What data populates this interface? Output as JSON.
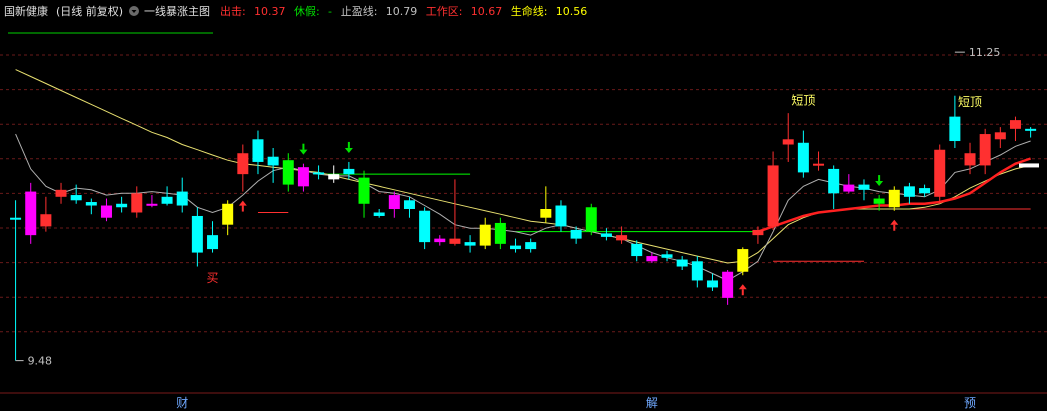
{
  "header": {
    "stock_name": "国新健康",
    "period_label": "(日线 前复权)",
    "indicator_name": "一线暴涨主图",
    "stats": [
      {
        "label": "出击:",
        "value": "10.37",
        "color": "#ff3030"
      },
      {
        "label": "休假:",
        "value": "-",
        "color": "#00e000"
      },
      {
        "label": "止盈线:",
        "value": "10.79",
        "color": "#c0c0c0"
      },
      {
        "label": "工作区:",
        "value": "10.67",
        "color": "#ff3030"
      },
      {
        "label": "生命线:",
        "value": "10.56",
        "color": "#ffff00"
      }
    ]
  },
  "chart_data": {
    "type": "candlestick",
    "ylim": [
      9.3,
      11.4
    ],
    "grid": true,
    "price_max_label": "11.25",
    "price_min_label": "9.48",
    "price_max": 11.25,
    "price_min": 9.48,
    "x_markers": [
      {
        "label": "财",
        "index": 11
      },
      {
        "label": "解",
        "index": 42
      },
      {
        "label": "预",
        "index": 63
      }
    ],
    "candles": [
      {
        "o": 10.3,
        "h": 10.4,
        "l": 9.48,
        "c": 10.3,
        "color": "#00ffff"
      },
      {
        "o": 10.2,
        "h": 10.5,
        "l": 10.15,
        "c": 10.45,
        "color": "#ff00ff"
      },
      {
        "o": 10.32,
        "h": 10.42,
        "l": 10.22,
        "c": 10.25,
        "color": "#ff3030"
      },
      {
        "o": 10.42,
        "h": 10.5,
        "l": 10.38,
        "c": 10.46,
        "color": "#ff3030"
      },
      {
        "o": 10.43,
        "h": 10.49,
        "l": 10.38,
        "c": 10.4,
        "color": "#00ffff"
      },
      {
        "o": 10.37,
        "h": 10.41,
        "l": 10.32,
        "c": 10.39,
        "color": "#00ffff"
      },
      {
        "o": 10.37,
        "h": 10.41,
        "l": 10.28,
        "c": 10.3,
        "color": "#ff00ff"
      },
      {
        "o": 10.38,
        "h": 10.42,
        "l": 10.33,
        "c": 10.36,
        "color": "#00ffff"
      },
      {
        "o": 10.33,
        "h": 10.48,
        "l": 10.3,
        "c": 10.44,
        "color": "#ff3030"
      },
      {
        "o": 10.37,
        "h": 10.43,
        "l": 10.36,
        "c": 10.38,
        "color": "#ff00ff"
      },
      {
        "o": 10.42,
        "h": 10.48,
        "l": 10.37,
        "c": 10.38,
        "color": "#00ffff"
      },
      {
        "o": 10.37,
        "h": 10.53,
        "l": 10.33,
        "c": 10.45,
        "color": "#00ffff"
      },
      {
        "o": 10.31,
        "h": 10.36,
        "l": 10.02,
        "c": 10.1,
        "color": "#00ffff"
      },
      {
        "o": 10.2,
        "h": 10.28,
        "l": 10.1,
        "c": 10.12,
        "color": "#00ffff"
      },
      {
        "o": 10.26,
        "h": 10.4,
        "l": 10.2,
        "c": 10.38,
        "color": "#ffff00"
      },
      {
        "o": 10.55,
        "h": 10.72,
        "l": 10.45,
        "c": 10.67,
        "color": "#ff3030"
      },
      {
        "o": 10.62,
        "h": 10.8,
        "l": 10.55,
        "c": 10.75,
        "color": "#00ffff"
      },
      {
        "o": 10.6,
        "h": 10.7,
        "l": 10.5,
        "c": 10.65,
        "color": "#00ffff"
      },
      {
        "o": 10.49,
        "h": 10.67,
        "l": 10.45,
        "c": 10.63,
        "color": "#00ff00"
      },
      {
        "o": 10.59,
        "h": 10.61,
        "l": 10.45,
        "c": 10.48,
        "color": "#ff00ff"
      },
      {
        "o": 10.55,
        "h": 10.6,
        "l": 10.52,
        "c": 10.56,
        "color": "#00ffff"
      },
      {
        "o": 10.55,
        "h": 10.6,
        "l": 10.5,
        "c": 10.52,
        "color": "#ffffff"
      },
      {
        "o": 10.58,
        "h": 10.62,
        "l": 10.52,
        "c": 10.55,
        "color": "#00ffff"
      },
      {
        "o": 10.53,
        "h": 10.57,
        "l": 10.3,
        "c": 10.38,
        "color": "#00ff00"
      },
      {
        "o": 10.33,
        "h": 10.35,
        "l": 10.3,
        "c": 10.31,
        "color": "#00ffff"
      },
      {
        "o": 10.43,
        "h": 10.45,
        "l": 10.3,
        "c": 10.35,
        "color": "#ff00ff"
      },
      {
        "o": 10.35,
        "h": 10.42,
        "l": 10.3,
        "c": 10.4,
        "color": "#00ffff"
      },
      {
        "o": 10.34,
        "h": 10.36,
        "l": 10.12,
        "c": 10.16,
        "color": "#00ffff"
      },
      {
        "o": 10.18,
        "h": 10.2,
        "l": 10.14,
        "c": 10.16,
        "color": "#ff00ff"
      },
      {
        "o": 10.18,
        "h": 10.52,
        "l": 10.14,
        "c": 10.15,
        "color": "#ff3030"
      },
      {
        "o": 10.16,
        "h": 10.2,
        "l": 10.1,
        "c": 10.14,
        "color": "#00ffff"
      },
      {
        "o": 10.14,
        "h": 10.3,
        "l": 10.12,
        "c": 10.26,
        "color": "#ffff00"
      },
      {
        "o": 10.15,
        "h": 10.3,
        "l": 10.12,
        "c": 10.27,
        "color": "#00ff00"
      },
      {
        "o": 10.14,
        "h": 10.18,
        "l": 10.1,
        "c": 10.12,
        "color": "#00ffff"
      },
      {
        "o": 10.12,
        "h": 10.18,
        "l": 10.1,
        "c": 10.16,
        "color": "#00ffff"
      },
      {
        "o": 10.35,
        "h": 10.48,
        "l": 10.27,
        "c": 10.3,
        "color": "#ffff00"
      },
      {
        "o": 10.37,
        "h": 10.4,
        "l": 10.22,
        "c": 10.25,
        "color": "#00ffff"
      },
      {
        "o": 10.23,
        "h": 10.25,
        "l": 10.15,
        "c": 10.18,
        "color": "#00ffff"
      },
      {
        "o": 10.36,
        "h": 10.38,
        "l": 10.2,
        "c": 10.22,
        "color": "#00ff00"
      },
      {
        "o": 10.21,
        "h": 10.24,
        "l": 10.17,
        "c": 10.19,
        "color": "#00ffff"
      },
      {
        "o": 10.2,
        "h": 10.25,
        "l": 10.15,
        "c": 10.17,
        "color": "#ff3030"
      },
      {
        "o": 10.15,
        "h": 10.17,
        "l": 10.05,
        "c": 10.08,
        "color": "#00ffff"
      },
      {
        "o": 10.08,
        "h": 10.1,
        "l": 10.04,
        "c": 10.05,
        "color": "#ff00ff"
      },
      {
        "o": 10.09,
        "h": 10.11,
        "l": 10.05,
        "c": 10.07,
        "color": "#00ffff"
      },
      {
        "o": 10.06,
        "h": 10.08,
        "l": 10.0,
        "c": 10.02,
        "color": "#00ffff"
      },
      {
        "o": 10.05,
        "h": 10.08,
        "l": 9.9,
        "c": 9.94,
        "color": "#00ffff"
      },
      {
        "o": 9.94,
        "h": 9.98,
        "l": 9.88,
        "c": 9.9,
        "color": "#00ffff"
      },
      {
        "o": 9.99,
        "h": 10.0,
        "l": 9.8,
        "c": 9.84,
        "color": "#ff00ff"
      },
      {
        "o": 9.99,
        "h": 10.13,
        "l": 9.97,
        "c": 10.12,
        "color": "#ffff00"
      },
      {
        "o": 10.2,
        "h": 10.25,
        "l": 10.15,
        "c": 10.23,
        "color": "#ff3030"
      },
      {
        "o": 10.25,
        "h": 10.68,
        "l": 10.23,
        "c": 10.6,
        "color": "#ff3030"
      },
      {
        "o": 10.75,
        "h": 10.9,
        "l": 10.62,
        "c": 10.72,
        "color": "#ff3030"
      },
      {
        "o": 10.73,
        "h": 10.8,
        "l": 10.53,
        "c": 10.56,
        "color": "#00ffff"
      },
      {
        "o": 10.6,
        "h": 10.68,
        "l": 10.57,
        "c": 10.61,
        "color": "#ff3030"
      },
      {
        "o": 10.58,
        "h": 10.6,
        "l": 10.35,
        "c": 10.44,
        "color": "#00ffff"
      },
      {
        "o": 10.49,
        "h": 10.55,
        "l": 10.44,
        "c": 10.45,
        "color": "#ff00ff"
      },
      {
        "o": 10.49,
        "h": 10.52,
        "l": 10.4,
        "c": 10.46,
        "color": "#00ffff"
      },
      {
        "o": 10.38,
        "h": 10.43,
        "l": 10.34,
        "c": 10.41,
        "color": "#00ff00"
      },
      {
        "o": 10.36,
        "h": 10.48,
        "l": 10.34,
        "c": 10.46,
        "color": "#ffff00"
      },
      {
        "o": 10.48,
        "h": 10.5,
        "l": 10.38,
        "c": 10.42,
        "color": "#00ffff"
      },
      {
        "o": 10.47,
        "h": 10.49,
        "l": 10.42,
        "c": 10.44,
        "color": "#00ffff"
      },
      {
        "o": 10.42,
        "h": 10.72,
        "l": 10.38,
        "c": 10.69,
        "color": "#ff3030"
      },
      {
        "o": 10.74,
        "h": 11.0,
        "l": 10.7,
        "c": 10.88,
        "color": "#00ffff"
      },
      {
        "o": 10.6,
        "h": 10.73,
        "l": 10.55,
        "c": 10.67,
        "color": "#ff3030"
      },
      {
        "o": 10.6,
        "h": 10.81,
        "l": 10.55,
        "c": 10.78,
        "color": "#ff3030"
      },
      {
        "o": 10.75,
        "h": 10.82,
        "l": 10.7,
        "c": 10.79,
        "color": "#ff3030"
      },
      {
        "o": 10.81,
        "h": 10.88,
        "l": 10.74,
        "c": 10.86,
        "color": "#ff3030"
      },
      {
        "o": 10.8,
        "h": 10.82,
        "l": 10.76,
        "c": 10.81,
        "color": "#00ffff"
      }
    ],
    "thin_line": [
      10.78,
      10.58,
      10.48,
      10.44,
      10.47,
      10.46,
      10.43,
      10.44,
      10.44,
      10.45,
      10.44,
      10.43,
      10.36,
      10.33,
      10.36,
      10.43,
      10.51,
      10.57,
      10.59,
      10.57,
      10.55,
      10.54,
      10.54,
      10.5,
      10.45,
      10.44,
      10.42,
      10.37,
      10.32,
      10.26,
      10.24,
      10.24,
      10.23,
      10.22,
      10.2,
      10.24,
      10.26,
      10.24,
      10.22,
      10.2,
      10.18,
      10.14,
      10.1,
      10.07,
      10.05,
      10.02,
      9.98,
      9.94,
      9.99,
      10.05,
      10.22,
      10.4,
      10.48,
      10.52,
      10.5,
      10.48,
      10.47,
      10.45,
      10.44,
      10.43,
      10.42,
      10.46,
      10.56,
      10.58,
      10.62,
      10.66,
      10.71,
      10.74
    ],
    "yellow_line": [
      11.15,
      11.11,
      11.07,
      11.03,
      10.99,
      10.95,
      10.91,
      10.87,
      10.83,
      10.79,
      10.76,
      10.72,
      10.69,
      10.66,
      10.63,
      10.61,
      10.6,
      10.59,
      10.58,
      10.57,
      10.56,
      10.54,
      10.52,
      10.5,
      10.48,
      10.46,
      10.44,
      10.42,
      10.4,
      10.38,
      10.36,
      10.34,
      10.32,
      10.3,
      10.28,
      10.27,
      10.26,
      10.24,
      10.22,
      10.2,
      10.18,
      10.16,
      10.14,
      10.12,
      10.1,
      10.08,
      10.06,
      10.04,
      10.05,
      10.1,
      10.18,
      10.26,
      10.3,
      10.33,
      10.34,
      10.35,
      10.35,
      10.35,
      10.35,
      10.35,
      10.36,
      10.38,
      10.42,
      10.47,
      10.51,
      10.55,
      10.58,
      10.6
    ],
    "red_line": {
      "start": 49,
      "values": [
        10.22,
        10.25,
        10.28,
        10.31,
        10.33,
        10.34,
        10.35,
        10.36,
        10.37,
        10.37,
        10.38,
        10.38,
        10.39,
        10.41,
        10.44,
        10.5,
        10.56,
        10.61,
        10.64
      ]
    },
    "hlines": [
      {
        "price": 10.55,
        "from": 20,
        "to": 30,
        "color": "#00ff00"
      },
      {
        "price": 10.22,
        "from": 33,
        "to": 49,
        "color": "#00ff00"
      },
      {
        "price": 10.33,
        "from": 16,
        "to": 18,
        "color": "#ff3030"
      },
      {
        "price": 10.05,
        "from": 50,
        "to": 56,
        "color": "#ff3030"
      },
      {
        "price": 10.35,
        "from": 59,
        "to": 67,
        "color": "#ff3030"
      }
    ],
    "arrows_up": [
      15,
      48,
      58
    ],
    "arrows_down": [
      19,
      22,
      57
    ],
    "annotations": [
      {
        "text": "买",
        "index": 13,
        "price": 9.93,
        "color": "#ff3030"
      },
      {
        "text": "短顶",
        "index": 52,
        "price": 10.95,
        "color": "#ffff66"
      },
      {
        "text": "短顶",
        "index": 63,
        "price": 10.94,
        "color": "#ffff66"
      }
    ]
  }
}
